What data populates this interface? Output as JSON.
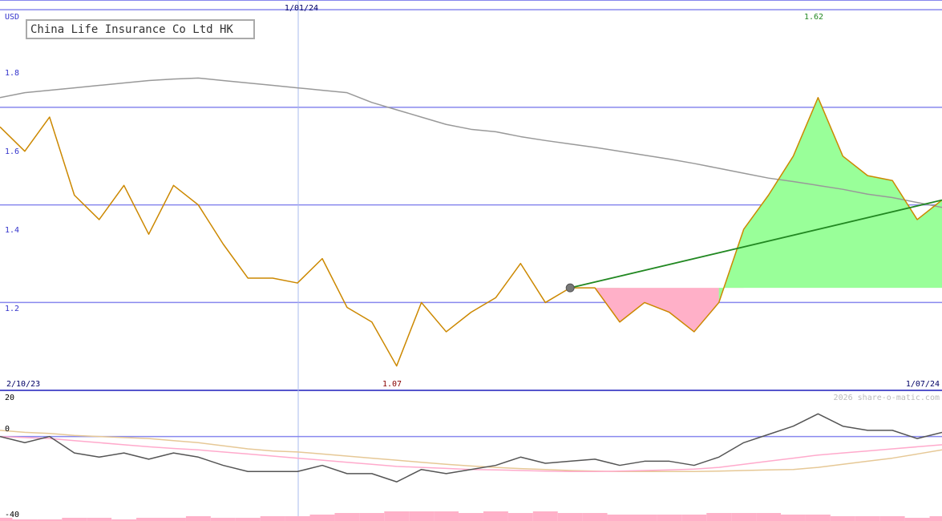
{
  "title": "China Life Insurance Co Ltd HK",
  "currency": "USD",
  "watermark": "2026 share-o-matic.com",
  "colors": {
    "price_line": "#cc8800",
    "ma_line": "#999999",
    "trend_line": "#228822",
    "gain_fill": "#99ff99",
    "loss_fill": "#ffb0c8",
    "grid": "#8888ee",
    "axis_label": "#3333cc",
    "high_label": "#228822",
    "low_label": "#880000",
    "date_label": "#000066",
    "osc_main": "#555555",
    "osc_pink": "#ffaacc",
    "osc_tan": "#e6c896",
    "volume": "#ffb0c8"
  },
  "chart_data": [
    {
      "type": "line",
      "panel": "price",
      "x_start_label": "2/10/23",
      "x_end_label": "1/07/24",
      "x_mid_label": "1/01/24",
      "high_label": "1.62",
      "low_label": "1.07",
      "y_ticks": [
        "1.2",
        "1.4",
        "1.6",
        "1.8"
      ],
      "ylim": [
        1.02,
        1.82
      ],
      "series": [
        {
          "values": [
            1.56,
            1.51,
            1.58,
            1.42,
            1.37,
            1.44,
            1.34,
            1.44,
            1.4,
            1.32,
            1.25,
            1.25,
            1.24,
            1.29,
            1.19,
            1.16,
            1.07,
            1.2,
            1.14,
            1.18,
            1.21,
            1.28,
            1.2,
            1.23,
            1.23,
            1.16,
            1.2,
            1.18,
            1.14,
            1.2,
            1.35,
            1.42,
            1.5,
            1.62,
            1.5,
            1.46,
            1.45,
            1.37,
            1.41
          ]
        },
        {
          "values": [
            1.62,
            1.63,
            1.635,
            1.64,
            1.645,
            1.65,
            1.655,
            1.658,
            1.66,
            1.655,
            1.65,
            1.645,
            1.64,
            1.635,
            1.63,
            1.61,
            1.595,
            1.58,
            1.565,
            1.555,
            1.55,
            1.54,
            1.532,
            1.525,
            1.518,
            1.51,
            1.502,
            1.494,
            1.485,
            1.475,
            1.465,
            1.455,
            1.448,
            1.44,
            1.432,
            1.422,
            1.415,
            1.405,
            1.395
          ]
        }
      ],
      "trend": {
        "start_index": 23,
        "start_value": 1.23,
        "end_value": 1.41
      }
    },
    {
      "type": "line",
      "panel": "oscillator",
      "y_ticks": [
        "20",
        "0",
        "-40"
      ],
      "ylim": [
        -41,
        22
      ],
      "series": [
        {
          "values": [
            0,
            -3,
            0,
            -8,
            -10,
            -8,
            -11,
            -8,
            -10,
            -14,
            -17,
            -17,
            -17,
            -14,
            -18,
            -18,
            -22,
            -16,
            -18,
            -16,
            -14,
            -10,
            -13,
            -12,
            -11,
            -14,
            -12,
            -12,
            -14,
            -10,
            -3,
            1,
            5,
            11,
            5,
            3,
            3,
            -1,
            2
          ]
        },
        {
          "values": [
            0,
            -0.5,
            -1,
            -2,
            -3,
            -4,
            -5,
            -5.8,
            -6.5,
            -7.5,
            -8.5,
            -9.5,
            -10.5,
            -11.5,
            -12.5,
            -13.5,
            -14.5,
            -15,
            -15.5,
            -16,
            -16.2,
            -16.5,
            -16.8,
            -17,
            -17,
            -16.8,
            -16.5,
            -16.2,
            -15.8,
            -15,
            -13.5,
            -12,
            -10.5,
            -9,
            -8,
            -7,
            -6,
            -5,
            -4
          ]
        },
        {
          "values": [
            3,
            2,
            1.5,
            0.5,
            0,
            -0.5,
            -1,
            -2,
            -3,
            -4.5,
            -6,
            -7,
            -7.5,
            -8.5,
            -9.5,
            -10.5,
            -11.5,
            -12.5,
            -13.5,
            -14.3,
            -15,
            -15.6,
            -16,
            -16.5,
            -16.8,
            -17,
            -17,
            -17,
            -17,
            -16.8,
            -16.5,
            -16.2,
            -16,
            -15,
            -13.5,
            -12,
            -10.5,
            -8.5,
            -6.5
          ]
        }
      ],
      "volume": [
        2,
        1,
        1,
        2,
        2,
        1,
        2,
        2,
        3,
        2,
        2,
        3,
        3,
        4,
        5,
        5,
        6,
        6,
        6,
        5,
        6,
        5,
        6,
        5,
        5,
        4,
        4,
        4,
        4,
        5,
        5,
        5,
        4,
        4,
        3,
        3,
        3,
        2,
        3
      ]
    }
  ]
}
